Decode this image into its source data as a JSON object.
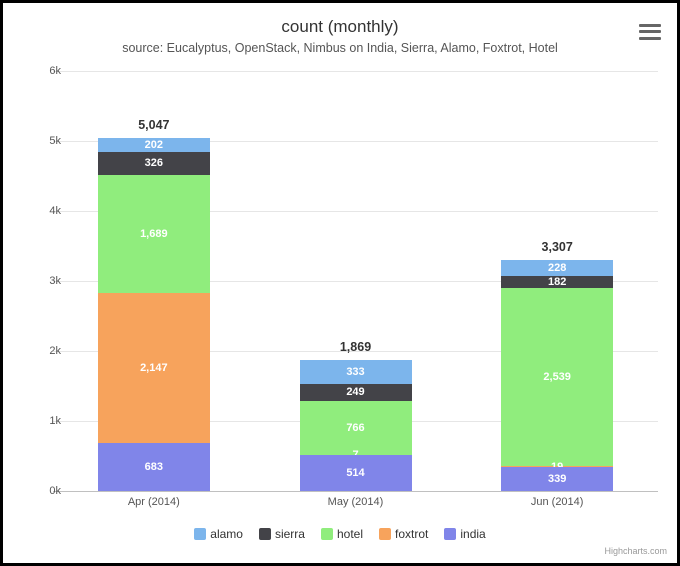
{
  "title": "count (monthly)",
  "subtitle": "source: Eucalyptus, OpenStack, Nimbus on India, Sierra, Alamo, Foxtrot, Hotel",
  "credits": "Highcharts.com",
  "legend": [
    {
      "name": "alamo",
      "color": "#7cb5ec"
    },
    {
      "name": "sierra",
      "color": "#434348"
    },
    {
      "name": "hotel",
      "color": "#90ed7d"
    },
    {
      "name": "foxtrot",
      "color": "#f7a35c"
    },
    {
      "name": "india",
      "color": "#8085e9"
    }
  ],
  "yticks": [
    "0k",
    "1k",
    "2k",
    "3k",
    "4k",
    "5k",
    "6k"
  ],
  "categories": [
    "Apr (2014)",
    "May (2014)",
    "Jun (2014)"
  ],
  "chart_data": {
    "type": "bar",
    "stacked": true,
    "title": "count (monthly)",
    "xlabel": "",
    "ylabel": "",
    "ylim": [
      0,
      6000
    ],
    "categories": [
      "Apr (2014)",
      "May (2014)",
      "Jun (2014)"
    ],
    "series": [
      {
        "name": "india",
        "values": [
          683,
          514,
          339
        ]
      },
      {
        "name": "foxtrot",
        "values": [
          2147,
          7,
          19
        ]
      },
      {
        "name": "hotel",
        "values": [
          1689,
          766,
          2539
        ]
      },
      {
        "name": "sierra",
        "values": [
          326,
          249,
          182
        ]
      },
      {
        "name": "alamo",
        "values": [
          202,
          333,
          228
        ]
      }
    ],
    "totals": [
      5047,
      1869,
      3307
    ]
  }
}
